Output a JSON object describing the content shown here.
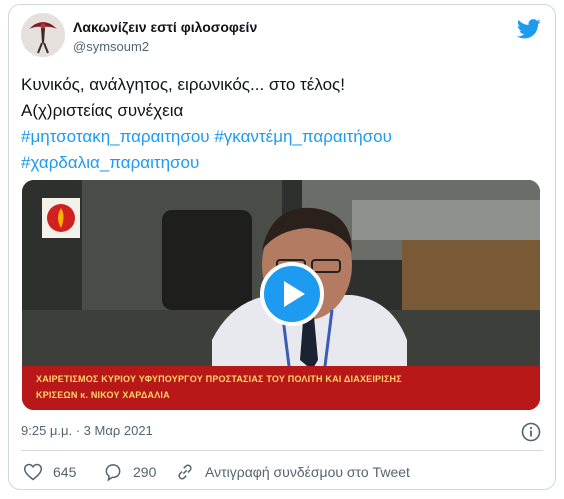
{
  "author": {
    "name": "Λακωνίζειν εστί φιλοσοφείν",
    "handle": "@symsoum2"
  },
  "tweet": {
    "line1": "Κυνικός, ανάλγητος, ειρωνικός... στο τέλος!",
    "line2": "Α(χ)ριστείας συνέχεια",
    "hashtags_line1": "#μητσοτακη_παραιτησου #γκαντέμη_παραιτήσου",
    "hashtags_line2": "#χαρδαλια_παραιτησου"
  },
  "video": {
    "caption_line1": "ΧΑΙΡΕΤΙΣΜΟΣ ΚΥΡΙΟΥ ΥΦΥΠΟΥΡΓΟΥ ΠΡΟΣΤΑΣΙΑΣ ΤΟΥ ΠΟΛΙΤΗ ΚΑΙ ΔΙΑΧΕΙΡΙΣΗΣ",
    "caption_line2": "ΚΡΙΣΕΩΝ κ. ΝΙΚΟΥ ΧΑΡΔΑΛΙΑ"
  },
  "timestamp": "9:25 μ.μ. · 3 Μαρ 2021",
  "actions": {
    "likes": "645",
    "replies": "290",
    "copy_link": "Αντιγραφή συνδέσμου στο Tweet"
  },
  "colors": {
    "accent": "#1d9bf0",
    "text": "#0f1419",
    "muted": "#536471",
    "border": "#cfd9de"
  }
}
